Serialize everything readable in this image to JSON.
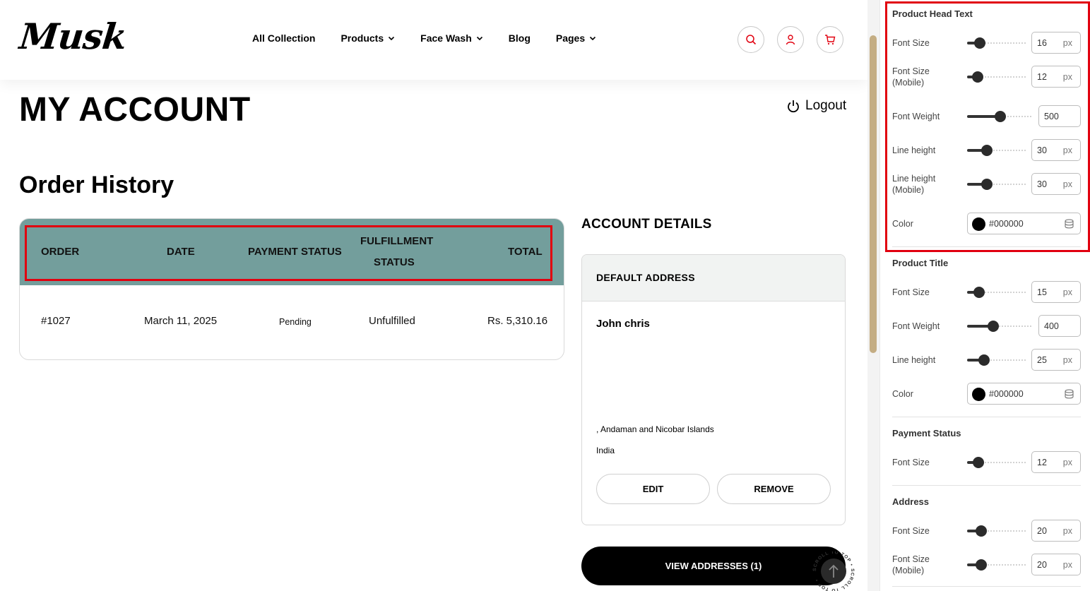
{
  "colors": {
    "accent": "#e1000f",
    "table_header": "#739e9c",
    "scrollbar_thumb": "#c4ad83",
    "swatch": "#000000"
  },
  "header": {
    "logo": "Musk",
    "nav": [
      {
        "label": "All Collection",
        "dropdown": false
      },
      {
        "label": "Products",
        "dropdown": true
      },
      {
        "label": "Face Wash",
        "dropdown": true
      },
      {
        "label": "Blog",
        "dropdown": false
      },
      {
        "label": "Pages",
        "dropdown": true
      }
    ],
    "icons": [
      "search-icon",
      "user-icon",
      "cart-icon"
    ]
  },
  "page": {
    "title": "MY ACCOUNT",
    "logout": "Logout",
    "order_history_title": "Order History"
  },
  "orders": {
    "headers": {
      "order": "ORDER",
      "date": "DATE",
      "payment": "PAYMENT STATUS",
      "fulfillment_1": "FULFILLMENT",
      "fulfillment_2": "STATUS",
      "total": "TOTAL"
    },
    "rows": [
      {
        "order": "#1027",
        "date": "March 11, 2025",
        "payment": "Pending",
        "fulfillment": "Unfulfilled",
        "total": "Rs. 5,310.16"
      }
    ]
  },
  "account": {
    "title": "ACCOUNT DETAILS",
    "default_address_label": "DEFAULT ADDRESS",
    "name": "John chris",
    "line1": ", Andaman and Nicobar Islands",
    "line2": "India",
    "edit": "EDIT",
    "remove": "REMOVE",
    "view_addresses": "VIEW ADDRESSES (1)"
  },
  "scroll_to_top": "SCROLL TO TOP",
  "settings": {
    "product_head_text": {
      "title": "Product Head Text",
      "font_size": {
        "label": "Font Size",
        "value": "16",
        "unit": "px"
      },
      "font_size_mobile": {
        "label1": "Font Size",
        "label2": "(Mobile)",
        "value": "12",
        "unit": "px"
      },
      "font_weight": {
        "label": "Font Weight",
        "value": "500"
      },
      "line_height": {
        "label": "Line height",
        "value": "30",
        "unit": "px"
      },
      "line_height_mobile": {
        "label1": "Line height",
        "label2": "(Mobile)",
        "value": "30",
        "unit": "px"
      },
      "color": {
        "label": "Color",
        "value": "#000000"
      }
    },
    "product_title": {
      "title": "Product Title",
      "font_size": {
        "label": "Font Size",
        "value": "15",
        "unit": "px"
      },
      "font_weight": {
        "label": "Font Weight",
        "value": "400"
      },
      "line_height": {
        "label": "Line height",
        "value": "25",
        "unit": "px"
      },
      "color": {
        "label": "Color",
        "value": "#000000"
      }
    },
    "payment_status": {
      "title": "Payment Status",
      "font_size": {
        "label": "Font Size",
        "value": "12",
        "unit": "px"
      }
    },
    "address": {
      "title": "Address",
      "font_size": {
        "label": "Font Size",
        "value": "20",
        "unit": "px"
      },
      "font_size_mobile": {
        "label1": "Font Size",
        "label2": "(Mobile)",
        "value": "20",
        "unit": "px"
      }
    }
  }
}
